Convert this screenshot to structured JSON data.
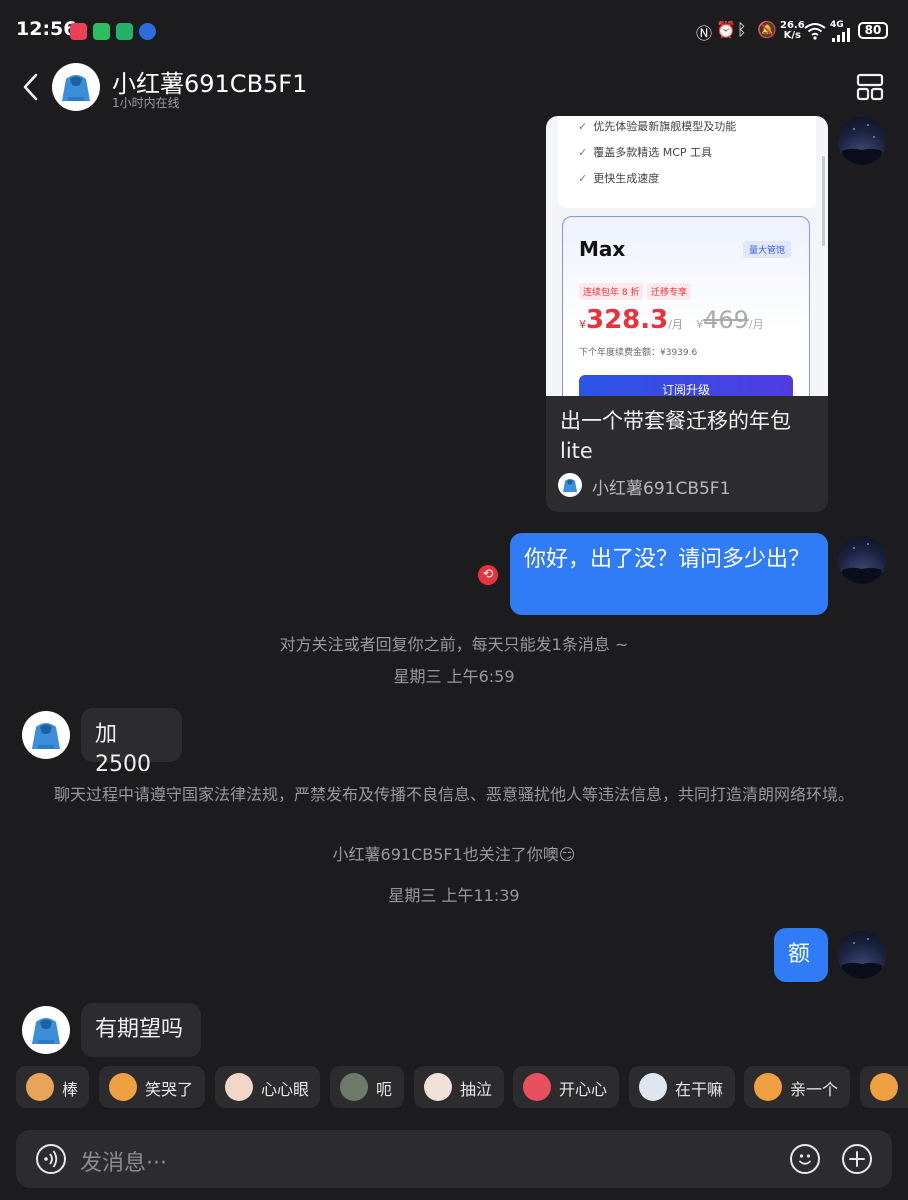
{
  "status_bar": {
    "time": "12:56",
    "net_speed_value": "26.6",
    "net_speed_unit": "K/s",
    "network": "4G",
    "battery": "80",
    "icons": [
      "nfc-icon",
      "alarm-icon",
      "bluetooth-icon",
      "mute-icon",
      "wifi-icon",
      "signal-icon",
      "battery-icon"
    ]
  },
  "header": {
    "contact_name": "小红薯691CB5F1",
    "online_status": "1小时内在线",
    "back_icon": "chevron-left-icon",
    "menu_icon": "layout-grid-icon"
  },
  "shared_card": {
    "features": [
      "优先体验最新旗舰模型及功能",
      "覆盖多款精选 MCP 工具",
      "更快生成速度"
    ],
    "plan_name": "Max",
    "plan_badge": "量大管饱",
    "tag_discount": "连续包年 8 折",
    "tag_migrate": "迁移专享",
    "price_currency": "¥",
    "price_new": "328.3",
    "price_unit": "/月",
    "price_old_currency": "¥",
    "price_old": "469",
    "price_old_unit": "/月",
    "next_renewal": "下个年度续费金额：¥3939.6",
    "subscribe_button": "订阅升级",
    "title": "出一个带套餐迁移的年包lite",
    "author": "小红薯691CB5F1"
  },
  "messages": {
    "me_question": "你好，出了没？请问多少出？",
    "limit_notice": "对方关注或者回复你之前，每天只能发1条消息 ~",
    "time1": "星期三 上午6:59",
    "them_offer": "加2500",
    "law_notice": "聊天过程中请遵守国家法律法规，严禁发布及传播不良信息、恶意骚扰他人等违法信息，共同打造清朗网络环境。",
    "follow_notice": "小红薯691CB5F1也关注了你噢",
    "follow_emoji": "😏",
    "time2": "星期三 上午11:39",
    "me_reply": "额",
    "them_question": "有期望吗"
  },
  "emoji_bar": [
    {
      "label": "棒",
      "icon": "cat-thumbs-up-icon",
      "color": "#e9a45b"
    },
    {
      "label": "笑哭了",
      "icon": "cat-laugh-cry-icon",
      "color": "#f0a040"
    },
    {
      "label": "心心眼",
      "icon": "cat-heart-eyes-icon",
      "color": "#f2d6c8"
    },
    {
      "label": "呃",
      "icon": "cat-awkward-icon",
      "color": "#6d7a6a"
    },
    {
      "label": "抽泣",
      "icon": "cat-sob-icon",
      "color": "#f1e1d8"
    },
    {
      "label": "开心心",
      "icon": "happy-heart-icon",
      "color": "#e85060"
    },
    {
      "label": "在干嘛",
      "icon": "peek-icon",
      "color": "#e0e6f0"
    },
    {
      "label": "亲一个",
      "icon": "cat-kiss-icon",
      "color": "#f0a040"
    },
    {
      "label": "",
      "icon": "cat-angry-icon",
      "color": "#f0a040"
    }
  ],
  "input": {
    "placeholder": "发消息···",
    "voice_icon": "voice-icon",
    "emoji_icon": "smiley-icon",
    "plus_icon": "plus-icon"
  },
  "colors": {
    "background": "#1c1c1e",
    "bubble_me": "#2f7cf6",
    "bubble_them": "#2c2c2f",
    "price_red": "#e8323c"
  }
}
